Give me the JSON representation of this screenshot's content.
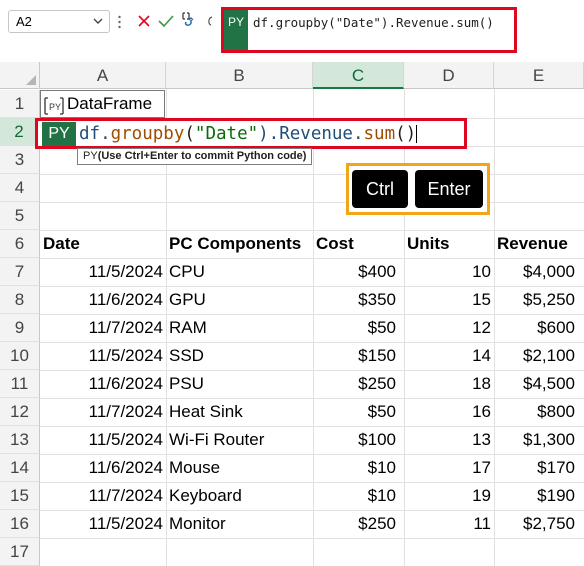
{
  "formula_bar": {
    "name_box": "A2",
    "py_badge": "PY",
    "formula": "df.groupby(\"Date\").Revenue.sum()"
  },
  "columns": [
    "A",
    "B",
    "C",
    "D",
    "E"
  ],
  "selected_column": "C",
  "rows": [
    "1",
    "2",
    "3",
    "4",
    "5",
    "6",
    "7",
    "8",
    "9",
    "10",
    "11",
    "12",
    "13",
    "14",
    "15",
    "16",
    "17"
  ],
  "cell_a1": {
    "label": "DataFrame"
  },
  "editing_cell": {
    "badge": "PY",
    "code_tokens": {
      "t1": "df.",
      "t2": "groupby",
      "t3": "(",
      "t4": "\"Date\"",
      "t5": ").Revenue.",
      "t6": "sum",
      "t7": "()"
    },
    "tooltip_prefix": "PY",
    "tooltip_text": "(Use Ctrl+Enter to commit Python code)"
  },
  "keys": {
    "ctrl": "Ctrl",
    "enter": "Enter"
  },
  "table": {
    "headers": [
      "Date",
      "PC Components",
      "Cost",
      "Units",
      "Revenue"
    ],
    "rows": [
      [
        "11/5/2024",
        "CPU",
        "$400",
        "10",
        "$4,000"
      ],
      [
        "11/6/2024",
        "GPU",
        "$350",
        "15",
        "$5,250"
      ],
      [
        "11/7/2024",
        "RAM",
        "$50",
        "12",
        "$600"
      ],
      [
        "11/5/2024",
        "SSD",
        "$150",
        "14",
        "$2,100"
      ],
      [
        "11/6/2024",
        "PSU",
        "$250",
        "18",
        "$4,500"
      ],
      [
        "11/7/2024",
        "Heat Sink",
        "$50",
        "16",
        "$800"
      ],
      [
        "11/5/2024",
        "Wi-Fi Router",
        "$100",
        "13",
        "$1,300"
      ],
      [
        "11/6/2024",
        "Mouse",
        "$10",
        "17",
        "$170"
      ],
      [
        "11/7/2024",
        "Keyboard",
        "$10",
        "19",
        "$190"
      ],
      [
        "11/5/2024",
        "Monitor",
        "$250",
        "11",
        "$2,750"
      ]
    ]
  },
  "colors": {
    "python_green": "#217346",
    "highlight_red": "#e0061f",
    "highlight_orange": "#f3a51a",
    "selected_header": "#d3e8da"
  },
  "icons": [
    "chevron-down-icon",
    "cancel-x-icon",
    "enter-check-icon",
    "python-insert-icon",
    "dataframe-icon"
  ]
}
